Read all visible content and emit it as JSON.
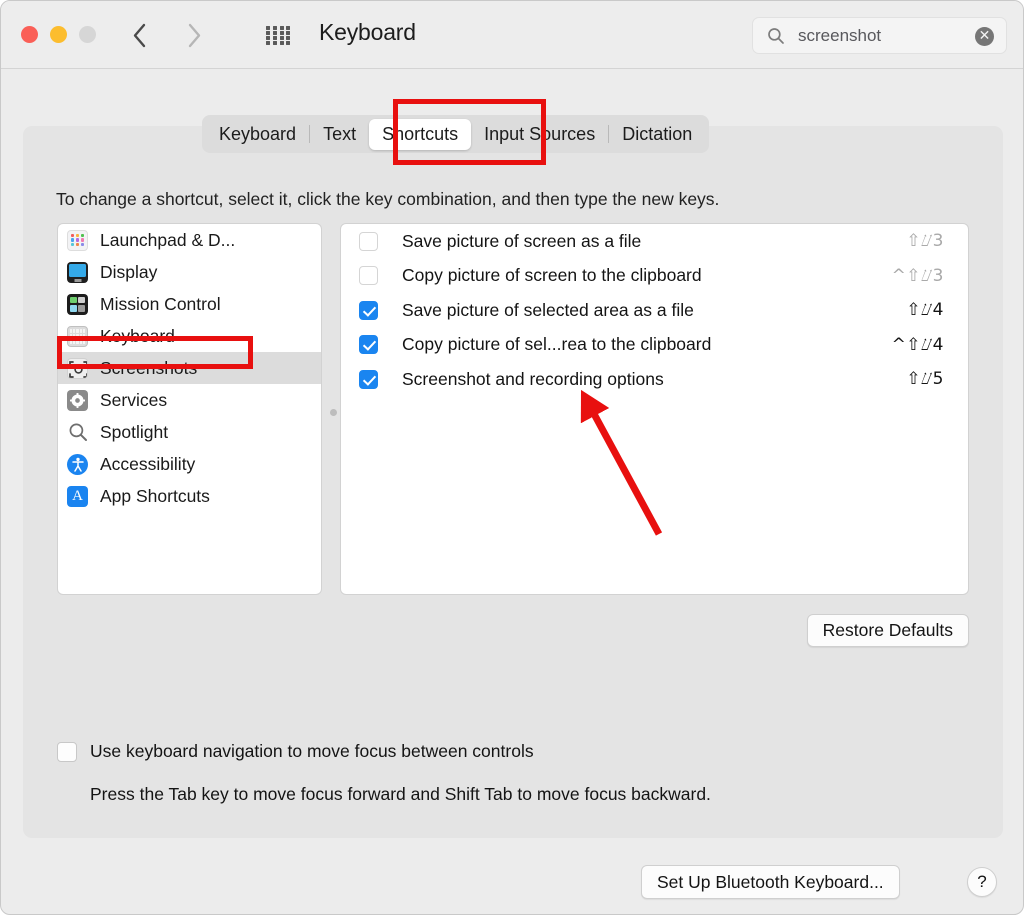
{
  "window": {
    "title": "Keyboard",
    "traffic_lights": [
      "close",
      "minimize",
      "zoom"
    ],
    "back_glyph": "‹",
    "forward_glyph": "›",
    "grid_icon": "show-all-icon"
  },
  "search": {
    "value": "screenshot",
    "placeholder": "Search",
    "icon": "search-icon",
    "clear_glyph": "✕"
  },
  "tabs": [
    {
      "label": "Keyboard",
      "selected": false
    },
    {
      "label": "Text",
      "selected": false
    },
    {
      "label": "Shortcuts",
      "selected": true
    },
    {
      "label": "Input Sources",
      "selected": false
    },
    {
      "label": "Dictation",
      "selected": false
    }
  ],
  "instruction": "To change a shortcut, select it, click the key combination, and then type the new keys.",
  "sidebar": {
    "items": [
      {
        "label": "Launchpad & D...",
        "icon": "launchpad-icon",
        "selected": false
      },
      {
        "label": "Display",
        "icon": "display-icon",
        "selected": false
      },
      {
        "label": "Mission Control",
        "icon": "mission-control-icon",
        "selected": false
      },
      {
        "label": "Keyboard",
        "icon": "keyboard-icon",
        "selected": false
      },
      {
        "label": "Screenshots",
        "icon": "screenshots-icon",
        "selected": true
      },
      {
        "label": "Services",
        "icon": "gear-icon",
        "selected": false
      },
      {
        "label": "Spotlight",
        "icon": "spotlight-icon",
        "selected": false
      },
      {
        "label": "Accessibility",
        "icon": "accessibility-icon",
        "selected": false
      },
      {
        "label": "App Shortcuts",
        "icon": "app-shortcuts-icon",
        "selected": false
      }
    ]
  },
  "shortcuts": {
    "rows": [
      {
        "label": "Save picture of screen as a file",
        "keys": "⇧⌰3",
        "checked": false
      },
      {
        "label": "Copy picture of screen to the clipboard",
        "keys": "^⇧⌰3",
        "checked": false
      },
      {
        "label": "Save picture of selected area as a file",
        "keys": "⇧⌰4",
        "checked": true
      },
      {
        "label": "Copy picture of sel...rea to the clipboard",
        "keys": "^⇧⌰4",
        "checked": true
      },
      {
        "label": "Screenshot and recording options",
        "keys": "⇧⌰5",
        "checked": true
      }
    ]
  },
  "buttons": {
    "restore_defaults": "Restore Defaults",
    "set_up_bluetooth_keyboard": "Set Up Bluetooth Keyboard...",
    "help": "?"
  },
  "keyboard_navigation": {
    "label": "Use keyboard navigation to move focus between controls",
    "checked": false,
    "hint": "Press the Tab key to move focus forward and Shift Tab to move focus backward."
  },
  "annotations": {
    "color": "#e8100f",
    "boxes": [
      "shortcuts-tab",
      "screenshots-sidebar-item"
    ],
    "arrow": "points-to-screenshot-and-recording-options-row"
  }
}
